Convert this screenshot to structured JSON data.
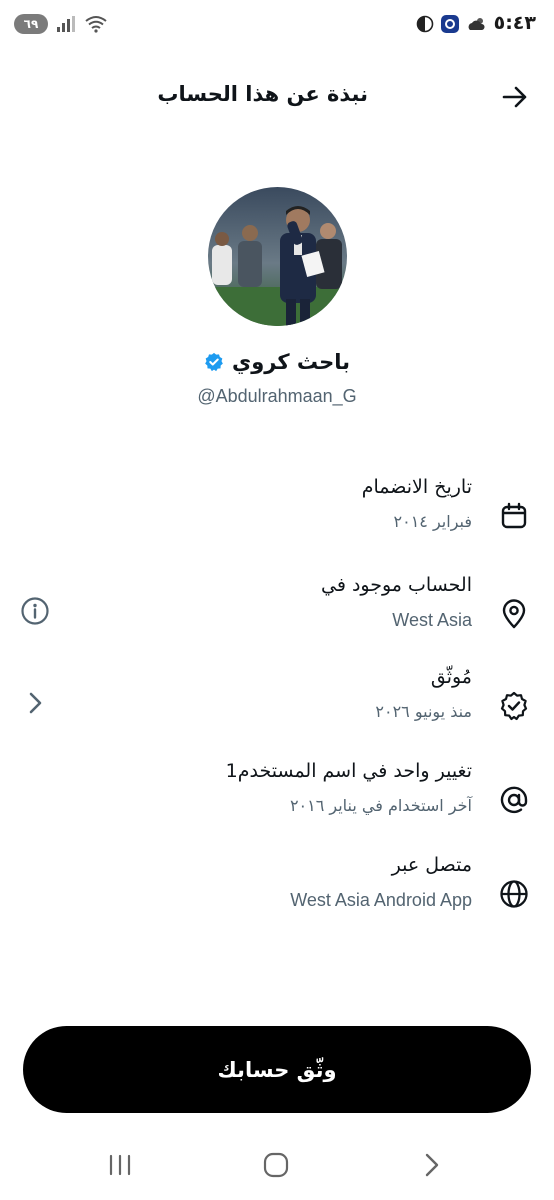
{
  "status_bar": {
    "time": "٥:٤٣",
    "battery": "٦٩"
  },
  "header": {
    "title": "نبذة عن هذا الحساب",
    "back_icon": "arrow-right-icon"
  },
  "profile": {
    "name": "باحث كروي",
    "handle": "@Abdulrahmaan_G",
    "verified": true,
    "accent": "#1d9bf0"
  },
  "rows": [
    {
      "icon": "calendar-icon",
      "title": "تاريخ الانضمام",
      "subtitle": "فبراير ٢٠١٤"
    },
    {
      "icon": "location-pin-icon",
      "title": "الحساب موجود في",
      "subtitle": "West Asia",
      "left_icon": "info-circle-icon"
    },
    {
      "icon": "verified-badge-icon",
      "title": "مُوثّق",
      "subtitle": "منذ يونيو ٢٠٢٦",
      "left_icon": "chevron-right-icon"
    },
    {
      "icon": "at-sign-icon",
      "title": "تغيير واحد في اسم المستخدم1",
      "subtitle": "آخر استخدام في يناير ٢٠١٦"
    },
    {
      "icon": "globe-icon",
      "title": "متصل عبر",
      "subtitle": "West Asia Android App"
    }
  ],
  "cta": {
    "label": "وثّق حسابك"
  },
  "nav": {
    "recents": "recents-icon",
    "home": "home-icon",
    "back": "back-icon"
  }
}
